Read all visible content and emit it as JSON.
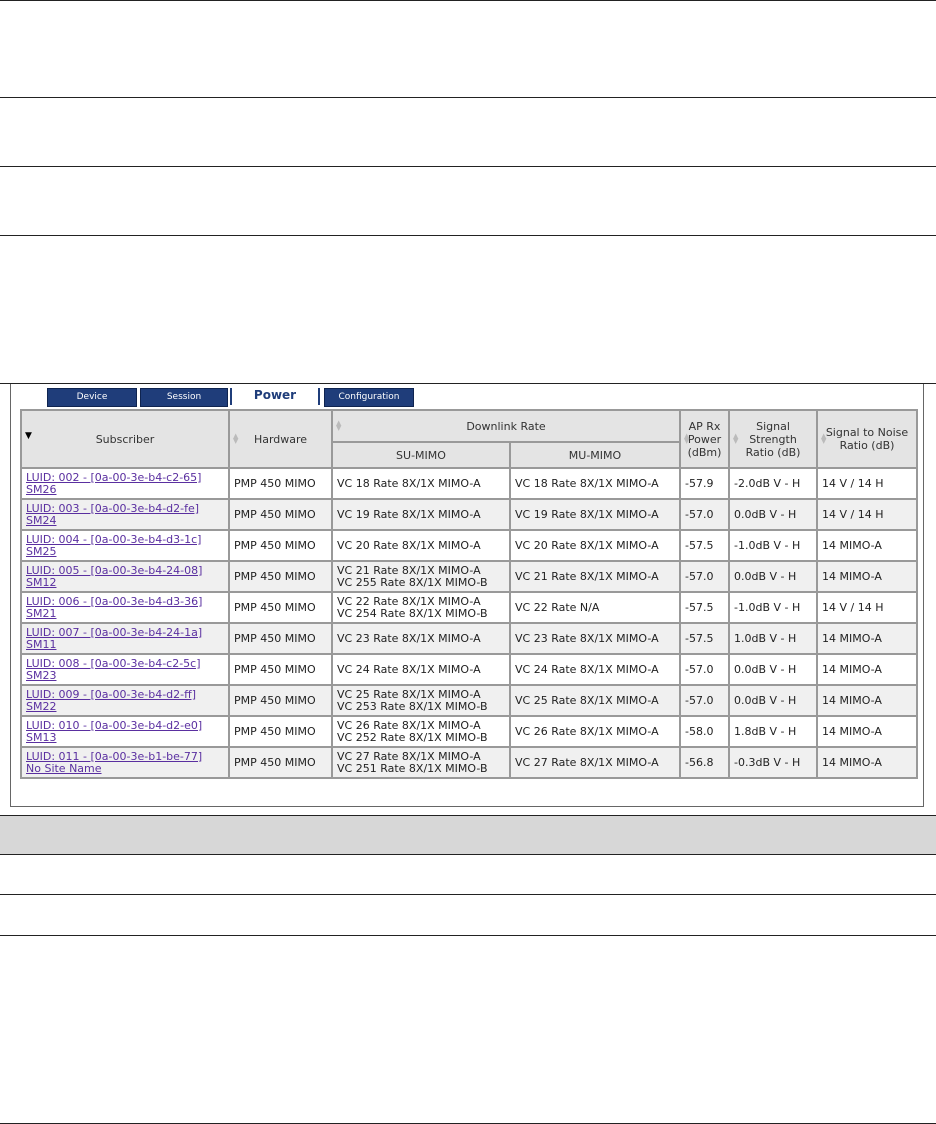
{
  "tabs": [
    "Device",
    "Session",
    "Power",
    "Configuration"
  ],
  "active_tab": "Power",
  "table": {
    "headers": {
      "subscriber": "Subscriber",
      "hardware": "Hardware",
      "downlink_rate": "Downlink Rate",
      "su_mimo": "SU-MIMO",
      "mu_mimo": "MU-MIMO",
      "ap_rx_power": "AP Rx Power (dBm)",
      "signal_strength_ratio": "Signal Strength Ratio (dB)",
      "snr": "Signal to Noise Ratio (dB)"
    },
    "rows": [
      {
        "luid": "LUID: 002 - [0a-00-3e-b4-c2-65]",
        "site": "SM26",
        "hardware": "PMP 450 MIMO",
        "su_mimo_1": "VC 18 Rate 8X/1X MIMO-A",
        "su_mimo_2": "",
        "mu_mimo": "VC 18 Rate 8X/1X MIMO-A",
        "ap_rx": "-57.9",
        "ssr": "-2.0dB V - H",
        "snr": "14 V / 14 H"
      },
      {
        "luid": "LUID: 003 - [0a-00-3e-b4-d2-fe]",
        "site": "SM24",
        "hardware": "PMP 450 MIMO",
        "su_mimo_1": "VC 19 Rate 8X/1X MIMO-A",
        "su_mimo_2": "",
        "mu_mimo": "VC 19 Rate 8X/1X MIMO-A",
        "ap_rx": "-57.0",
        "ssr": "0.0dB V - H",
        "snr": "14 V / 14 H"
      },
      {
        "luid": "LUID: 004 - [0a-00-3e-b4-d3-1c]",
        "site": "SM25",
        "hardware": "PMP 450 MIMO",
        "su_mimo_1": "VC 20 Rate 8X/1X MIMO-A",
        "su_mimo_2": "",
        "mu_mimo": "VC 20 Rate 8X/1X MIMO-A",
        "ap_rx": "-57.5",
        "ssr": "-1.0dB V - H",
        "snr": "14 MIMO-A"
      },
      {
        "luid": "LUID: 005 - [0a-00-3e-b4-24-08]",
        "site": "SM12",
        "hardware": "PMP 450 MIMO",
        "su_mimo_1": "VC 21 Rate 8X/1X MIMO-A",
        "su_mimo_2": "VC 255 Rate 8X/1X MIMO-B",
        "mu_mimo": "VC 21 Rate 8X/1X MIMO-A",
        "ap_rx": "-57.0",
        "ssr": "0.0dB V - H",
        "snr": "14 MIMO-A"
      },
      {
        "luid": "LUID: 006 - [0a-00-3e-b4-d3-36]",
        "site": "SM21",
        "hardware": "PMP 450 MIMO",
        "su_mimo_1": "VC 22 Rate 8X/1X MIMO-A",
        "su_mimo_2": "VC 254 Rate 8X/1X MIMO-B",
        "mu_mimo": "VC 22 Rate N/A",
        "ap_rx": "-57.5",
        "ssr": "-1.0dB V - H",
        "snr": "14 V / 14 H"
      },
      {
        "luid": "LUID: 007 - [0a-00-3e-b4-24-1a]",
        "site": "SM11",
        "hardware": "PMP 450 MIMO",
        "su_mimo_1": "VC 23 Rate 8X/1X MIMO-A",
        "su_mimo_2": "",
        "mu_mimo": "VC 23 Rate 8X/1X MIMO-A",
        "ap_rx": "-57.5",
        "ssr": "1.0dB V - H",
        "snr": "14 MIMO-A"
      },
      {
        "luid": "LUID: 008 - [0a-00-3e-b4-c2-5c]",
        "site": "SM23",
        "hardware": "PMP 450 MIMO",
        "su_mimo_1": "VC 24 Rate 8X/1X MIMO-A",
        "su_mimo_2": "",
        "mu_mimo": "VC 24 Rate 8X/1X MIMO-A",
        "ap_rx": "-57.0",
        "ssr": "0.0dB V - H",
        "snr": "14 MIMO-A"
      },
      {
        "luid": "LUID: 009 - [0a-00-3e-b4-d2-ff]",
        "site": "SM22",
        "hardware": "PMP 450 MIMO",
        "su_mimo_1": "VC 25 Rate 8X/1X MIMO-A",
        "su_mimo_2": "VC 253 Rate 8X/1X MIMO-B",
        "mu_mimo": "VC 25 Rate 8X/1X MIMO-A",
        "ap_rx": "-57.0",
        "ssr": "0.0dB V - H",
        "snr": "14 MIMO-A"
      },
      {
        "luid": "LUID: 010 - [0a-00-3e-b4-d2-e0]",
        "site": "SM13",
        "hardware": "PMP 450 MIMO",
        "su_mimo_1": "VC 26 Rate 8X/1X MIMO-A",
        "su_mimo_2": "VC 252 Rate 8X/1X MIMO-B",
        "mu_mimo": "VC 26 Rate 8X/1X MIMO-A",
        "ap_rx": "-58.0",
        "ssr": "1.8dB V - H",
        "snr": "14 MIMO-A"
      },
      {
        "luid": "LUID: 011 - [0a-00-3e-b1-be-77]",
        "site": "No Site Name",
        "hardware": "PMP 450 MIMO",
        "su_mimo_1": "VC 27 Rate 8X/1X MIMO-A",
        "su_mimo_2": "VC 251 Rate 8X/1X MIMO-B",
        "mu_mimo": "VC 27 Rate 8X/1X MIMO-A",
        "ap_rx": "-56.8",
        "ssr": "-0.3dB V - H",
        "snr": "14 MIMO-A"
      }
    ]
  }
}
